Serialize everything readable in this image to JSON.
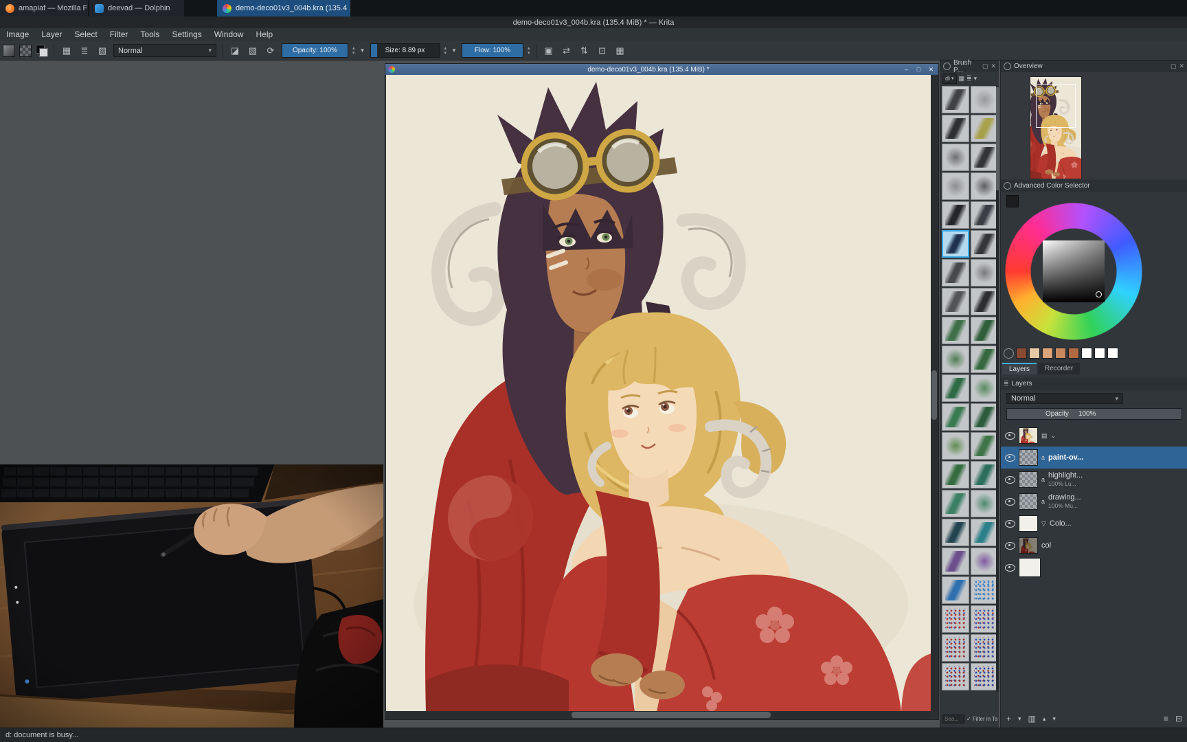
{
  "glyphs": {
    "close": "✕",
    "float": "▢",
    "min": "–",
    "max": "□",
    "chevron_down": "▾",
    "chevron_up": "▴",
    "caret": "⌄",
    "plus": "+",
    "check": "✓",
    "menu": "≡",
    "grid": "▦",
    "rows": "≣",
    "checker": "▨",
    "reload": "⟳",
    "mirror_h": "⇄",
    "mirror_v": "⇅",
    "trim": "⊡",
    "save": "▣",
    "eraser": "◪",
    "lock_alpha": "▧",
    "doc": "▤",
    "filter": "▽",
    "duplicate": "▥",
    "delete": "⊟",
    "alpha": "a"
  },
  "taskbar": {
    "windows": [
      {
        "label": "amapiaf — Mozilla Firefox"
      },
      {
        "label": "deevad — Dolphin"
      },
      {
        "label": "demo-deco01v3_004b.kra (135.4 ..."
      }
    ]
  },
  "titlebar": {
    "title": "demo-deco01v3_004b.kra (135.4 MiB) * — Krita"
  },
  "menubar": {
    "items": [
      "Image",
      "Layer",
      "Select",
      "Filter",
      "Tools",
      "Settings",
      "Window",
      "Help"
    ]
  },
  "toolbar": {
    "blend_mode": "Normal",
    "opacity": "Opacity: 100%",
    "size": "Size: 8.89 px",
    "flow": "Flow: 100%"
  },
  "subwindow": {
    "title": "demo-deco01v3_004b.kra (135.4 MiB) *"
  },
  "brush_docker": {
    "title": "Brush P...",
    "mode": "di",
    "search": "Sea...",
    "filter_label": "Filter in Tag",
    "selected_index": 10,
    "presets": [
      {
        "t": "stroke",
        "c": "#3f4145"
      },
      {
        "t": "soft",
        "c": "#97999b"
      },
      {
        "t": "stroke",
        "c": "#2d2f33"
      },
      {
        "t": "stroke",
        "c": "#a8a14b"
      },
      {
        "t": "soft",
        "c": "#6d6f72"
      },
      {
        "t": "stroke",
        "c": "#323438"
      },
      {
        "t": "soft",
        "c": "#8b8d90"
      },
      {
        "t": "soft",
        "c": "#5c5e62"
      },
      {
        "t": "stroke",
        "c": "#24262c"
      },
      {
        "t": "stroke",
        "c": "#3a3d44"
      },
      {
        "t": "stroke",
        "c": "#1e3250"
      },
      {
        "t": "stroke",
        "c": "#34363a"
      },
      {
        "t": "stroke",
        "c": "#46484c"
      },
      {
        "t": "soft",
        "c": "#77797c"
      },
      {
        "t": "stroke",
        "c": "#515356"
      },
      {
        "t": "stroke",
        "c": "#2c2e32"
      },
      {
        "t": "stroke",
        "c": "#3f6f48"
      },
      {
        "t": "stroke",
        "c": "#2f5e3a"
      },
      {
        "t": "soft",
        "c": "#4e7d54"
      },
      {
        "t": "stroke",
        "c": "#35683e"
      },
      {
        "t": "stroke",
        "c": "#2e6b46"
      },
      {
        "t": "soft",
        "c": "#578a5f"
      },
      {
        "t": "stroke",
        "c": "#3a7a52"
      },
      {
        "t": "stroke",
        "c": "#2c5c3c"
      },
      {
        "t": "soft",
        "c": "#618c52"
      },
      {
        "t": "stroke",
        "c": "#3f7348"
      },
      {
        "t": "stroke",
        "c": "#356d41"
      },
      {
        "t": "stroke",
        "c": "#2d6f5c"
      },
      {
        "t": "stroke",
        "c": "#3b7f65"
      },
      {
        "t": "soft",
        "c": "#4e8a72"
      },
      {
        "t": "stroke",
        "c": "#224550"
      },
      {
        "t": "stroke",
        "c": "#2b7f88"
      },
      {
        "t": "stroke",
        "c": "#6a4f8c"
      },
      {
        "t": "soft",
        "c": "#7e5aa2"
      },
      {
        "t": "stroke",
        "c": "#2e6fae"
      },
      {
        "t": "dots",
        "c": "#3b7fc4"
      },
      {
        "t": "dots",
        "c": "#b03a34",
        "c2": "#3a58b0"
      },
      {
        "t": "dots",
        "c": "#3a58b0",
        "c2": "#b03a34"
      },
      {
        "t": "dots",
        "c": "#a03430",
        "c2": "#2f4da8"
      },
      {
        "t": "dots",
        "c": "#2f4da8",
        "c2": "#a03430"
      },
      {
        "t": "dots",
        "c": "#96302c",
        "c2": "#2a46a0"
      },
      {
        "t": "dots",
        "c": "#2a46a0",
        "c2": "#96302c"
      }
    ]
  },
  "overview": {
    "title": "Overview"
  },
  "color_selector": {
    "title": "Advanced Color Selector"
  },
  "color_history": {
    "swatches": [
      "#8a4a32",
      "#e7c9a6",
      "#dca378",
      "#c8895e",
      "#b26a42",
      "#ffffff",
      "#ffffff",
      "#ffffff"
    ]
  },
  "layers": {
    "tabs": [
      "Layers",
      "Recorder"
    ],
    "title": "Layers",
    "blend_mode": "Normal",
    "opacity_label": "Opacity",
    "opacity_value": "100%",
    "rows": [
      {
        "name": ""
      },
      {
        "name": "paint-ov..."
      },
      {
        "name": "highlight...",
        "info": "100% Lu..."
      },
      {
        "name": "drawing...",
        "info": "100% Mu..."
      },
      {
        "name": "Colo..."
      },
      {
        "name": "col"
      },
      {
        "name": ""
      }
    ]
  },
  "statusbar": {
    "text": "d: document is busy..."
  }
}
